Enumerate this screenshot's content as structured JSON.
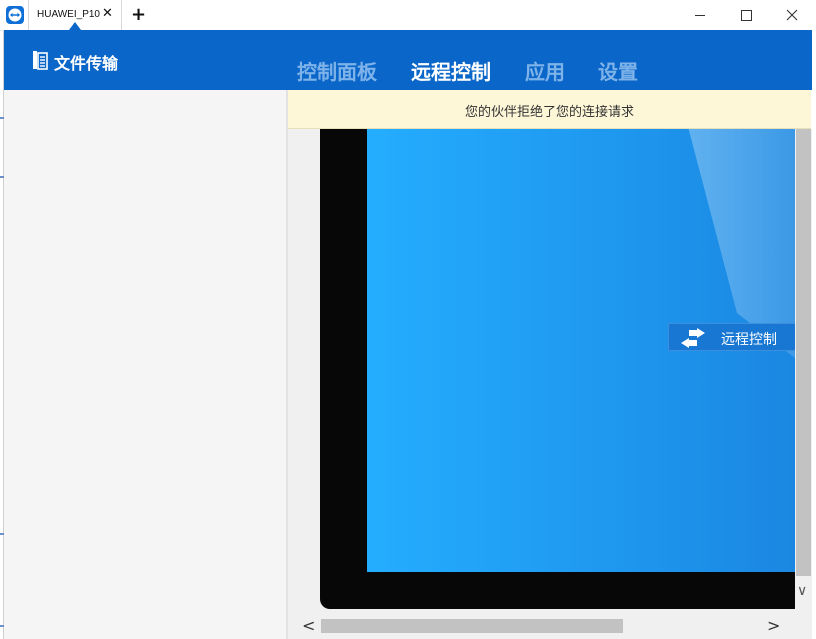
{
  "window": {
    "tab_label": "HUAWEI_P10",
    "tab_close": "✕",
    "new_tab": "+"
  },
  "header": {
    "file_transfer_label": "文件传输",
    "nav": [
      {
        "label": "控制面板",
        "active": false
      },
      {
        "label": "远程控制",
        "active": true
      },
      {
        "label": "应用",
        "active": false
      },
      {
        "label": "设置",
        "active": false
      }
    ]
  },
  "notification": {
    "text": "您的伙伴拒绝了您的连接请求"
  },
  "device_screen": {
    "button_label": "远程控制"
  },
  "scrollbars": {
    "down_arrow": "∨",
    "left_arrow": "<",
    "right_arrow": ">"
  },
  "colors": {
    "header_bg": "#0a66c8",
    "nav_inactive": "#7eb3ea",
    "notice_bg": "#fdf7d8",
    "screen_blue": "#24adfe"
  },
  "icons": [
    "teamviewer-icon",
    "close-icon",
    "plus-icon",
    "minimize-icon",
    "maximize-icon",
    "window-close-icon",
    "file-transfer-icon",
    "swap-arrows-icon"
  ]
}
